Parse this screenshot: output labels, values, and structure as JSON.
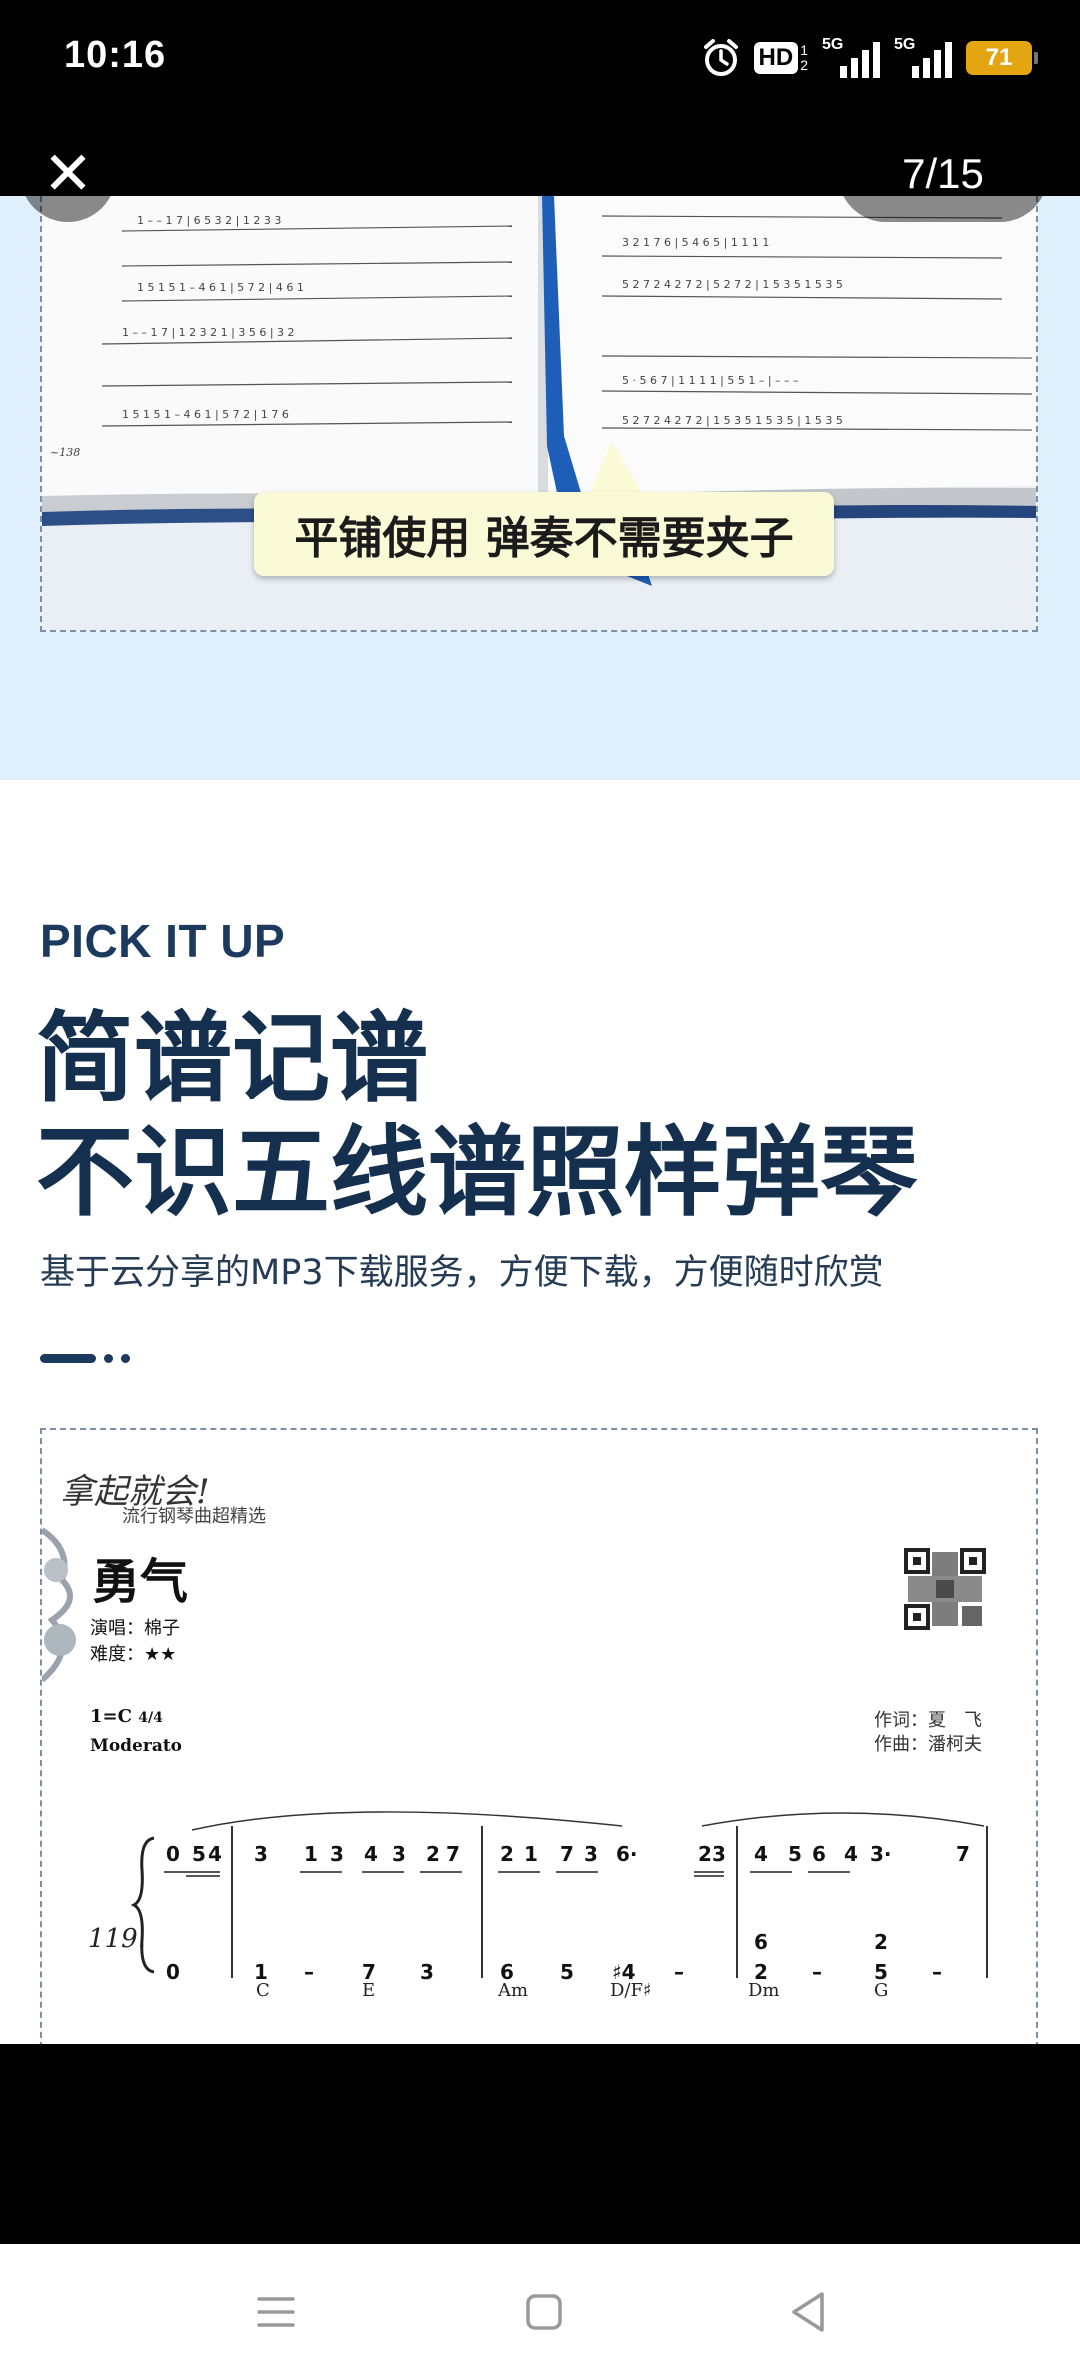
{
  "status_bar": {
    "time": "10:16",
    "hd_label": "HD",
    "hd_sub_top": "1",
    "hd_sub_bottom": "2",
    "signal1_label": "5G",
    "signal2_label": "5G",
    "battery_level": "71"
  },
  "viewer": {
    "close_label": "✕",
    "page_counter": "7/15"
  },
  "section1": {
    "caption": "平铺使用 弹奏不需要夹子"
  },
  "section2": {
    "eyebrow": "PICK IT UP",
    "headline_line1": "简谱记谱",
    "headline_line2": "不识五线谱照样弹琴",
    "subtitle": "基于云分享的MP3下载服务，方便下载，方便随时欣赏"
  },
  "score": {
    "series_logo": "拿起就会!",
    "series_name": "流行钢琴曲超精选",
    "title": "勇气",
    "singer": "演唱：棉子",
    "difficulty": "难度：★★",
    "key": "1=C",
    "time_sig": "4/4",
    "tempo": "Moderato",
    "lyricist": "作词：夏　飞",
    "composer": "作曲：潘柯夫",
    "measure_number": "119.",
    "chords": [
      "C",
      "E",
      "Am",
      "D/F♯",
      "Dm",
      "G"
    ],
    "upper_notes": [
      "0",
      "5",
      "4",
      "3",
      "1",
      "3",
      "4",
      "3",
      "2",
      "7",
      "2",
      "1",
      "7",
      "3",
      "6·",
      "2",
      "3",
      "4",
      "5",
      "6",
      "4",
      "3·",
      "7"
    ],
    "lower_notes": [
      "0",
      "1",
      "–",
      "7",
      "3",
      "6",
      "5",
      "♯4",
      "–",
      "6",
      "2",
      "–",
      "2",
      "5",
      "–"
    ]
  },
  "nav": {
    "menu": "menu-icon",
    "home": "home-icon",
    "back": "back-icon"
  },
  "colors": {
    "section1_bg": "#dff0fc",
    "headline": "#15304f",
    "battery": "#e3a612",
    "caption_bg": "#fafbd6"
  }
}
